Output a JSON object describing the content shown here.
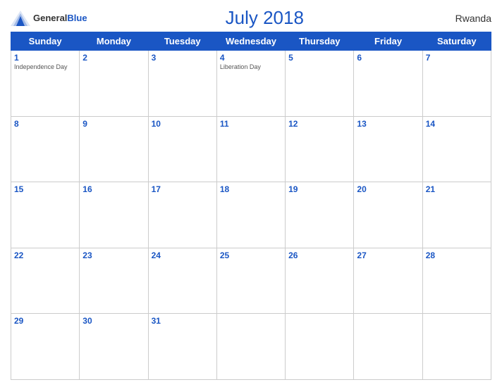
{
  "header": {
    "logo_general": "General",
    "logo_blue": "Blue",
    "title": "July 2018",
    "country": "Rwanda"
  },
  "days_of_week": [
    "Sunday",
    "Monday",
    "Tuesday",
    "Wednesday",
    "Thursday",
    "Friday",
    "Saturday"
  ],
  "weeks": [
    [
      {
        "day": "1",
        "holiday": "Independence Day"
      },
      {
        "day": "2",
        "holiday": ""
      },
      {
        "day": "3",
        "holiday": ""
      },
      {
        "day": "4",
        "holiday": "Liberation Day"
      },
      {
        "day": "5",
        "holiday": ""
      },
      {
        "day": "6",
        "holiday": ""
      },
      {
        "day": "7",
        "holiday": ""
      }
    ],
    [
      {
        "day": "8",
        "holiday": ""
      },
      {
        "day": "9",
        "holiday": ""
      },
      {
        "day": "10",
        "holiday": ""
      },
      {
        "day": "11",
        "holiday": ""
      },
      {
        "day": "12",
        "holiday": ""
      },
      {
        "day": "13",
        "holiday": ""
      },
      {
        "day": "14",
        "holiday": ""
      }
    ],
    [
      {
        "day": "15",
        "holiday": ""
      },
      {
        "day": "16",
        "holiday": ""
      },
      {
        "day": "17",
        "holiday": ""
      },
      {
        "day": "18",
        "holiday": ""
      },
      {
        "day": "19",
        "holiday": ""
      },
      {
        "day": "20",
        "holiday": ""
      },
      {
        "day": "21",
        "holiday": ""
      }
    ],
    [
      {
        "day": "22",
        "holiday": ""
      },
      {
        "day": "23",
        "holiday": ""
      },
      {
        "day": "24",
        "holiday": ""
      },
      {
        "day": "25",
        "holiday": ""
      },
      {
        "day": "26",
        "holiday": ""
      },
      {
        "day": "27",
        "holiday": ""
      },
      {
        "day": "28",
        "holiday": ""
      }
    ],
    [
      {
        "day": "29",
        "holiday": ""
      },
      {
        "day": "30",
        "holiday": ""
      },
      {
        "day": "31",
        "holiday": ""
      },
      {
        "day": "",
        "holiday": ""
      },
      {
        "day": "",
        "holiday": ""
      },
      {
        "day": "",
        "holiday": ""
      },
      {
        "day": "",
        "holiday": ""
      }
    ]
  ]
}
